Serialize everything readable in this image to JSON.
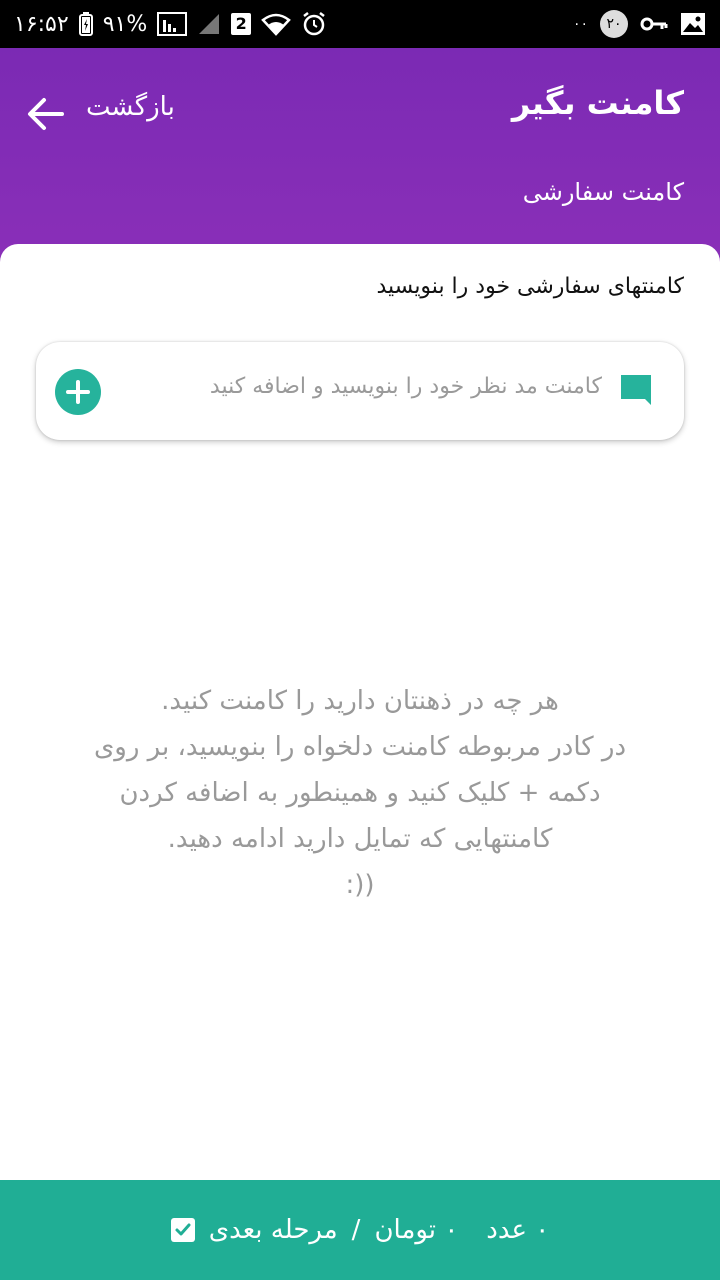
{
  "status_bar": {
    "time": "۱۶:۵۲",
    "battery_percent": "۹۱%",
    "sim_badge": "2",
    "notification_count": "۲۰",
    "dots": "۰۰"
  },
  "header": {
    "title": "کامنت بگیر",
    "back_label": "بازگشت",
    "subtitle": "کامنت سفارشی",
    "color": "#7b2ab4"
  },
  "main": {
    "section_title": "کامنتهای سفارشی خود را بنویسید",
    "input": {
      "value": "",
      "placeholder": "کامنت مد نظر خود را بنویسید و اضافه کنید"
    },
    "hint_lines": [
      "هر چه در ذهنتان دارید را کامنت کنید.",
      "در کادر مربوطه کامنت دلخواه را بنویسید، بر روی",
      "دکمه + کلیک کنید و همینطور به اضافه کردن",
      "کامنتهایی که تمایل دارید ادامه دهید.",
      ":))"
    ],
    "accent_color": "#26b39c"
  },
  "footer": {
    "count_text": "۰ عدد",
    "price_text": "۰ تومان",
    "separator": "/",
    "next_label": "مرحله بعدی",
    "color": "#20ae95"
  }
}
